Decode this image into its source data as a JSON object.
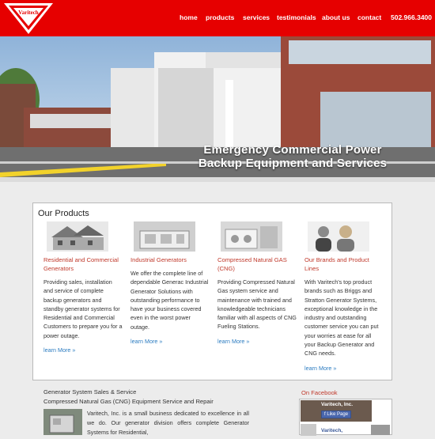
{
  "header": {
    "logo_text": "Varitech",
    "nav": [
      {
        "label": "home"
      },
      {
        "label": "products"
      },
      {
        "label": "services"
      },
      {
        "label": "testimonials"
      },
      {
        "label": "about us"
      },
      {
        "label": "contact"
      },
      {
        "label": "502.966.3400"
      }
    ]
  },
  "hero": {
    "line1": "Emergency Commercial Power",
    "line2": "Backup Equipment and Services"
  },
  "products": {
    "heading": "Our Products",
    "items": [
      {
        "title": "Residential and Commercial Generators",
        "desc": "Providing sales, installation and service of complete backup generators and standby generator systems for Residential and Commercial Customers to prepare you for a power outage.",
        "more": "learn More »"
      },
      {
        "title": "Industrial Generators",
        "desc": "We offer the complete line of dependable Generac Industrial Generator Solutions with outstanding performance to have your business covered even in the worst power outage.",
        "more": "learn More »"
      },
      {
        "title": "Compressed Natural GAS (CNG)",
        "desc": "Providing Compressed Natural Gas system service and maintenance with trained and knowledgeable technicians familiar with all aspects of CNG Fueling Stations.",
        "more": "learn More »"
      },
      {
        "title": "Our Brands and Product Lines",
        "desc": "With Varitech's top product brands such as Briggs and Stratton Generator Systems, exceptional knowledge in the industry and outstanding customer service you can put your worries at ease for all your Backup Generator and CNG needs.",
        "more": "learn More »"
      }
    ]
  },
  "about": {
    "title1": "Generator System Sales & Service",
    "title2": "Compressed Natural Gas (CNG) Equipment Service and Repair",
    "para": "Varitech, Inc. is a small business dedicated to excellence in all we do. Our generator division offers complete Generator Systems for Residential,"
  },
  "facebook": {
    "heading": "On Facebook",
    "page_name": "Varitech, Inc.",
    "like_label": "Like Page",
    "name2": "Varitech,"
  },
  "colors": {
    "brand_red": "#e60000",
    "link_blue": "#2a7bc0",
    "title_red": "#c0392b"
  }
}
